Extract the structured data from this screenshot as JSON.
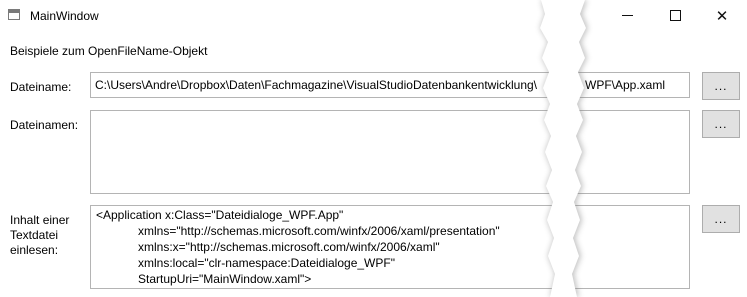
{
  "window": {
    "title": "MainWindow",
    "icon": "window-icon",
    "controls": [
      "minimize-icon",
      "maximize-icon",
      "close-icon"
    ],
    "close_glyph": "✕"
  },
  "heading": "Beispiele zum OpenFileName-Objekt",
  "rows": {
    "file": {
      "label": "Dateiname:",
      "value_start": "C:\\Users\\Andre\\Dropbox\\Daten\\Fachmagazine\\VisualStudioDatenbankentwicklung\\",
      "value_end": "WPF\\App.xaml",
      "button_label": "..."
    },
    "files": {
      "label": "Dateinamen:",
      "value": "",
      "button_label": "..."
    },
    "content": {
      "label_lines": [
        "Inhalt einer",
        "Textdatei",
        "einlesen:"
      ],
      "lines": [
        "<Application x:Class=\"Dateidialoge_WPF.App\"",
        "xmlns=\"http://schemas.microsoft.com/winfx/2006/xaml/presentation\"",
        "xmlns:x=\"http://schemas.microsoft.com/winfx/2006/xaml\"",
        "xmlns:local=\"clr-namespace:Dateidialoge_WPF\"",
        "StartupUri=\"MainWindow.xaml\">"
      ],
      "button_label": "..."
    }
  },
  "colors": {
    "border": "#b4b4b4",
    "button_bg": "#e1e1e1",
    "button_border": "#adadad"
  }
}
